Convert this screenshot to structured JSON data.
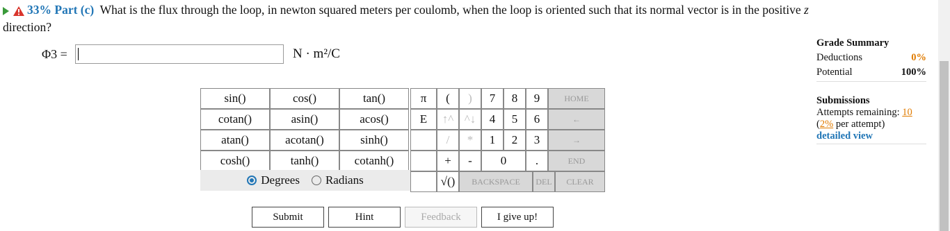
{
  "question": {
    "part_label": "33% Part (c)",
    "text": "What is the flux through the loop, in newton squared meters per coulomb, when the loop is oriented such that its normal vector is in the positive",
    "var": "z",
    "text2": "direction?"
  },
  "answer": {
    "label": "Φ3 =",
    "value": "",
    "unit": "N · m²/C"
  },
  "keypad": {
    "functions": [
      [
        "sin()",
        "cos()",
        "tan()"
      ],
      [
        "cotan()",
        "asin()",
        "acos()"
      ],
      [
        "atan()",
        "acotan()",
        "sinh()"
      ],
      [
        "cosh()",
        "tanh()",
        "cotanh()"
      ]
    ],
    "symbols": [
      "π",
      "(",
      ")",
      "E",
      "↑^",
      "^↓",
      "/",
      "*",
      "+",
      "-",
      "√()"
    ],
    "digits": [
      "7",
      "8",
      "9",
      "4",
      "5",
      "6",
      "1",
      "2",
      "3",
      "0",
      "."
    ],
    "nav": [
      "HOME",
      "←",
      "→",
      "END"
    ],
    "bottom": [
      "BACKSPACE",
      "DEL",
      "CLEAR"
    ],
    "degrees": "Degrees",
    "radians": "Radians"
  },
  "buttons": {
    "submit": "Submit",
    "hint": "Hint",
    "feedback": "Feedback",
    "giveup": "I give up!"
  },
  "grade_summary": {
    "title": "Grade Summary",
    "deductions_label": "Deductions",
    "deductions_value": "0%",
    "potential_label": "Potential",
    "potential_value": "100%"
  },
  "submissions": {
    "title": "Submissions",
    "attempts_label": "Attempts remaining:",
    "attempts_value": "10",
    "per_attempt_value": "2%",
    "per_attempt_label": "per attempt)",
    "link": "detailed view"
  },
  "colors": {
    "accent": "#2176b6",
    "orange": "#e07b00",
    "green": "#3a9a3a"
  }
}
